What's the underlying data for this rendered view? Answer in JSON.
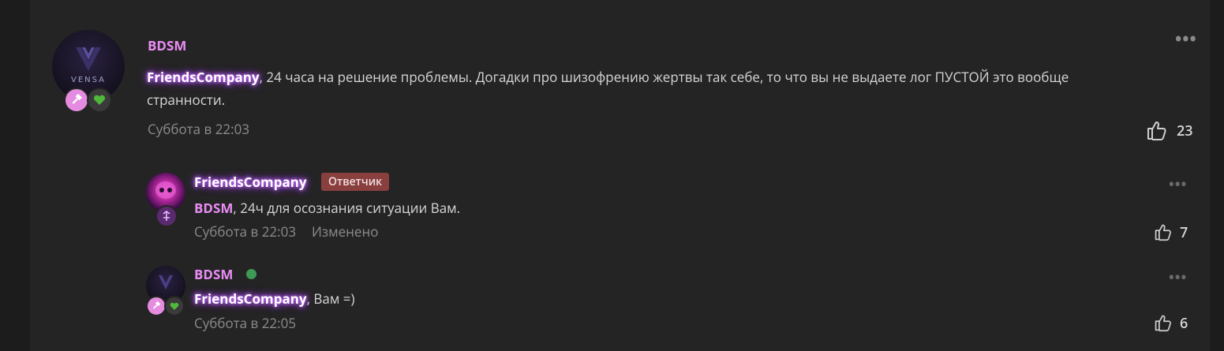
{
  "main_comment": {
    "author": "BDSM",
    "mention": "FriendsCompany",
    "text": ", 24 часа на решение проблемы. Догадки про шизофрению жертвы так себе, то что вы не выдаете лог ПУСТОЙ это вообще",
    "text_line2": "странности.",
    "timestamp": "Суббота в 22:03",
    "likes": "23",
    "avatar_text": "VENSA",
    "menu_icon": "more-horizontal-icon"
  },
  "replies": [
    {
      "author": "FriendsCompany",
      "role": "Ответчик",
      "mention": "BDSM",
      "text": ", 24ч для осознания ситуации Вам.",
      "timestamp": "Суббота в 22:03",
      "edited": "Изменено",
      "likes": "7"
    },
    {
      "author": "BDSM",
      "mention": "FriendsCompany",
      "text": ", Вам =)",
      "timestamp": "Суббота в 22:05",
      "likes": "6"
    }
  ],
  "colors": {
    "background": "#1c1c1c",
    "panel": "#242424",
    "username": "#e88cf2",
    "role_tag": "#8a3f3f",
    "online": "#3e9a55",
    "badge_pink": "#e58be0",
    "badge_heart": "#4fb83b"
  }
}
